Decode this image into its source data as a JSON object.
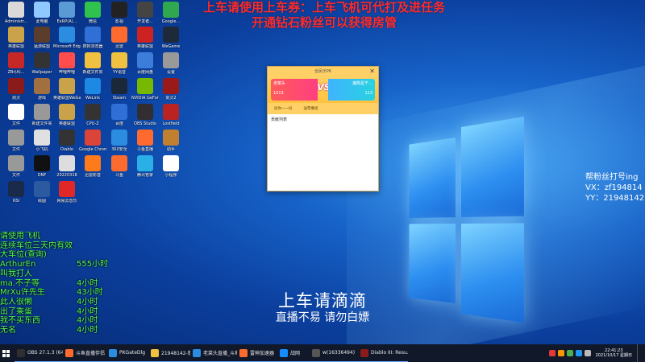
{
  "overlay": {
    "top_line1": "上车请使用上车券：上车飞机可代打及进任务",
    "top_line2": "开通钻石粉丝可以获得房管",
    "right_line1": "帮粉丝打号ing",
    "right_line2": "VX：zf194814",
    "right_line3": "YY：21948142",
    "center_title": "上车请滴滴",
    "center_sub": "直播不易 请勿白嫖"
  },
  "chat": [
    {
      "name": "请使用飞机",
      "val": ""
    },
    {
      "name": "连续车位三天内有效",
      "val": ""
    },
    {
      "name": "大车位(查询)",
      "val": ""
    },
    {
      "name": "ArthurEn",
      "val": "555小时"
    },
    {
      "name": "叫我打人",
      "val": ""
    },
    {
      "name": "ma.不子等",
      "val": "4小时"
    },
    {
      "name": "MrXu许先生",
      "val": "43小时"
    },
    {
      "name": "此人很懒",
      "val": "4小时"
    },
    {
      "name": "出了乘蛋",
      "val": "4小时"
    },
    {
      "name": "我不买东西",
      "val": "4小时"
    },
    {
      "name": "无名",
      "val": "4小时"
    }
  ],
  "popup": {
    "title": "全民乐PK",
    "close": "✕",
    "left_name": "老菜头",
    "left_num": "1013",
    "vs": "VS",
    "right_name": "魔羯星千...",
    "right_num": "113",
    "action1": "投你一一份",
    "action2": "送票撒组",
    "body_text": "贡献列表"
  },
  "desktop_icons": [
    {
      "label": "Administr...",
      "color": "#d9d9d9"
    },
    {
      "label": "此电脑",
      "color": "#8fc9ff"
    },
    {
      "label": "ExRP(A)...",
      "color": "#5b9bd5"
    },
    {
      "label": "微信",
      "color": "#2fc24d"
    },
    {
      "label": "影视",
      "color": "#222"
    },
    {
      "label": "开发者...",
      "color": "#444"
    },
    {
      "label": "Google...",
      "color": "#2fa84f"
    },
    {
      "label": "英雄联盟",
      "color": "#c9a24a"
    },
    {
      "label": "猛游联盟",
      "color": "#5a3e2b"
    },
    {
      "label": "Microsoft Edge",
      "color": "#2c8de0"
    },
    {
      "label": "搜狗浏览器",
      "color": "#2f6fd6"
    },
    {
      "label": "迅雷",
      "color": "#ff6b2e"
    },
    {
      "label": "英雄联盟",
      "color": "#cc2222"
    },
    {
      "label": "WeGame",
      "color": "#1e2a3a"
    },
    {
      "label": "ZBr(A)...",
      "color": "#c62828"
    },
    {
      "label": "Wallpaper",
      "color": "#333"
    },
    {
      "label": "哔哩哔哩",
      "color": "#ff4d4d"
    },
    {
      "label": "新建文件夹",
      "color": "#f0c040"
    },
    {
      "label": "YY语音",
      "color": "#f0c040"
    },
    {
      "label": "百度网盘",
      "color": "#3b7dd8"
    },
    {
      "label": "设置",
      "color": "#999"
    },
    {
      "label": "剑灵",
      "color": "#8b1a1a"
    },
    {
      "label": "游戏",
      "color": "#a07040"
    },
    {
      "label": "英雄联盟WeGame",
      "color": "#c9a24a"
    },
    {
      "label": "WeLink",
      "color": "#1e88e5"
    },
    {
      "label": "Steam",
      "color": "#1b2838"
    },
    {
      "label": "NVIDIA GeForce",
      "color": "#76b900"
    },
    {
      "label": "剑灵2",
      "color": "#9a1a1a"
    },
    {
      "label": "文件",
      "color": "#fff"
    },
    {
      "label": "新建文件夹",
      "color": "#999"
    },
    {
      "label": "英雄联盟",
      "color": "#c9a24a"
    },
    {
      "label": "CPU-Z",
      "color": "#333"
    },
    {
      "label": "百度",
      "color": "#2f6fd6"
    },
    {
      "label": "OBS Studio",
      "color": "#302e31"
    },
    {
      "label": "Lostfield",
      "color": "#bb2222"
    },
    {
      "label": "文件",
      "color": "#999"
    },
    {
      "label": "小飞机",
      "color": "#e0e0e0"
    },
    {
      "label": "Diablo",
      "color": "#333"
    },
    {
      "label": "Google Chrome",
      "color": "#db4437"
    },
    {
      "label": "360安全",
      "color": "#2c8de0"
    },
    {
      "label": "斗鱼直播",
      "color": "#ff6b2e"
    },
    {
      "label": "助手",
      "color": "#c08030"
    },
    {
      "label": "文件",
      "color": "#999"
    },
    {
      "label": "DNF",
      "color": "#111"
    },
    {
      "label": "20220318",
      "color": "#ddd"
    },
    {
      "label": "迅雷影音",
      "color": "#ff7a1a"
    },
    {
      "label": "斗鱼",
      "color": "#ff6b2e"
    },
    {
      "label": "腾讯管家",
      "color": "#2ab0e6"
    },
    {
      "label": "小程序",
      "color": "#ffffff"
    },
    {
      "label": "RSI",
      "color": "#1a2a4a"
    },
    {
      "label": "绘图",
      "color": "#2c5aa0"
    },
    {
      "label": "网易云音乐",
      "color": "#e02828"
    }
  ],
  "taskbar": {
    "items": [
      {
        "label": "OBS 27.1.3 (64)...",
        "color": "#302e31"
      },
      {
        "label": "斗鱼直播伴侣",
        "color": "#ff6b2e"
      },
      {
        "label": "PKGateDlg",
        "color": "#2c8de0"
      },
      {
        "label": "21948142-新版...",
        "color": "#f0c040"
      },
      {
        "label": "老菜头直播_斗鱼...",
        "color": "#2c8de0"
      },
      {
        "label": "雷神加速器",
        "color": "#ff6b2e"
      },
      {
        "label": "战网",
        "color": "#148eff"
      },
      {
        "label": "w(16336494)",
        "color": "#555"
      },
      {
        "label": "Diablo III: Resu...",
        "color": "#8b1a1a"
      }
    ],
    "time": "22:41:23",
    "date": "2021/10/17 星期日"
  }
}
